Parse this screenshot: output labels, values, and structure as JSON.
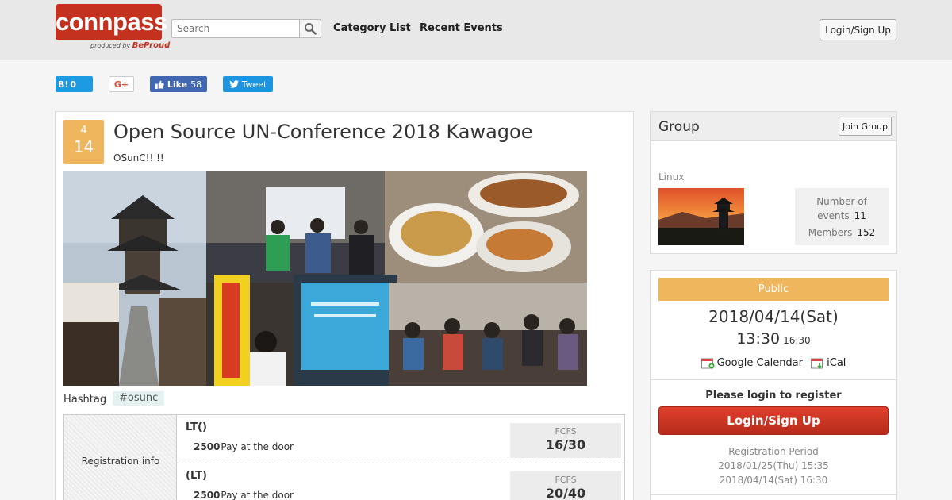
{
  "header": {
    "logo_text": "connpass",
    "logo_sub_prefix": "produced by",
    "logo_sub_brand": "BeProud",
    "search_placeholder": "Search",
    "nav": [
      "Category List",
      "Recent Events"
    ],
    "login_label": "Login/Sign Up"
  },
  "social": {
    "hatena_label": "B!",
    "hatena_count": "0",
    "gplus_label": "G+",
    "fb_label": "Like",
    "fb_count": "58",
    "tweet_label": "Tweet"
  },
  "event": {
    "month": "4",
    "day": "14",
    "title": "Open Source UN-Conference 2018 Kawagoe",
    "subtitle": "OSunC!! !!",
    "hashtag_label": "Hashtag",
    "hashtag": "#osunc"
  },
  "registration": {
    "header": "Registration info",
    "tickets": [
      {
        "name": "LT()",
        "price": "2500",
        "price_note": "Pay at the door",
        "capacity_label": "FCFS",
        "capacity": "16/30"
      },
      {
        "name": "(LT)",
        "price": "2500",
        "price_note": "Pay at the door",
        "capacity_label": "FCFS",
        "capacity": "20/40"
      }
    ]
  },
  "group": {
    "heading": "Group",
    "join_label": "Join Group",
    "name": "Linux",
    "events_label": "Number of events",
    "events_count": "11",
    "members_label": "Members",
    "members_count": "152"
  },
  "sidebar_event": {
    "visibility": "Public",
    "date": "2018/04/14(Sat)",
    "start_time": "13:30",
    "end_time": "16:30",
    "google_calendar": "Google Calendar",
    "ical": "iCal",
    "login_note": "Please login to register",
    "login_button": "Login/Sign Up",
    "period_label": "Registration Period",
    "period_start": "2018/01/25(Thu) 15:35",
    "period_end": "2018/04/14(Sat) 16:30"
  },
  "colors": {
    "brand_red": "#c5311f",
    "accent_orange": "#f0b65d",
    "hatena_blue": "#1d9be2",
    "facebook_blue": "#4267b2",
    "twitter_blue": "#1b95e0"
  }
}
